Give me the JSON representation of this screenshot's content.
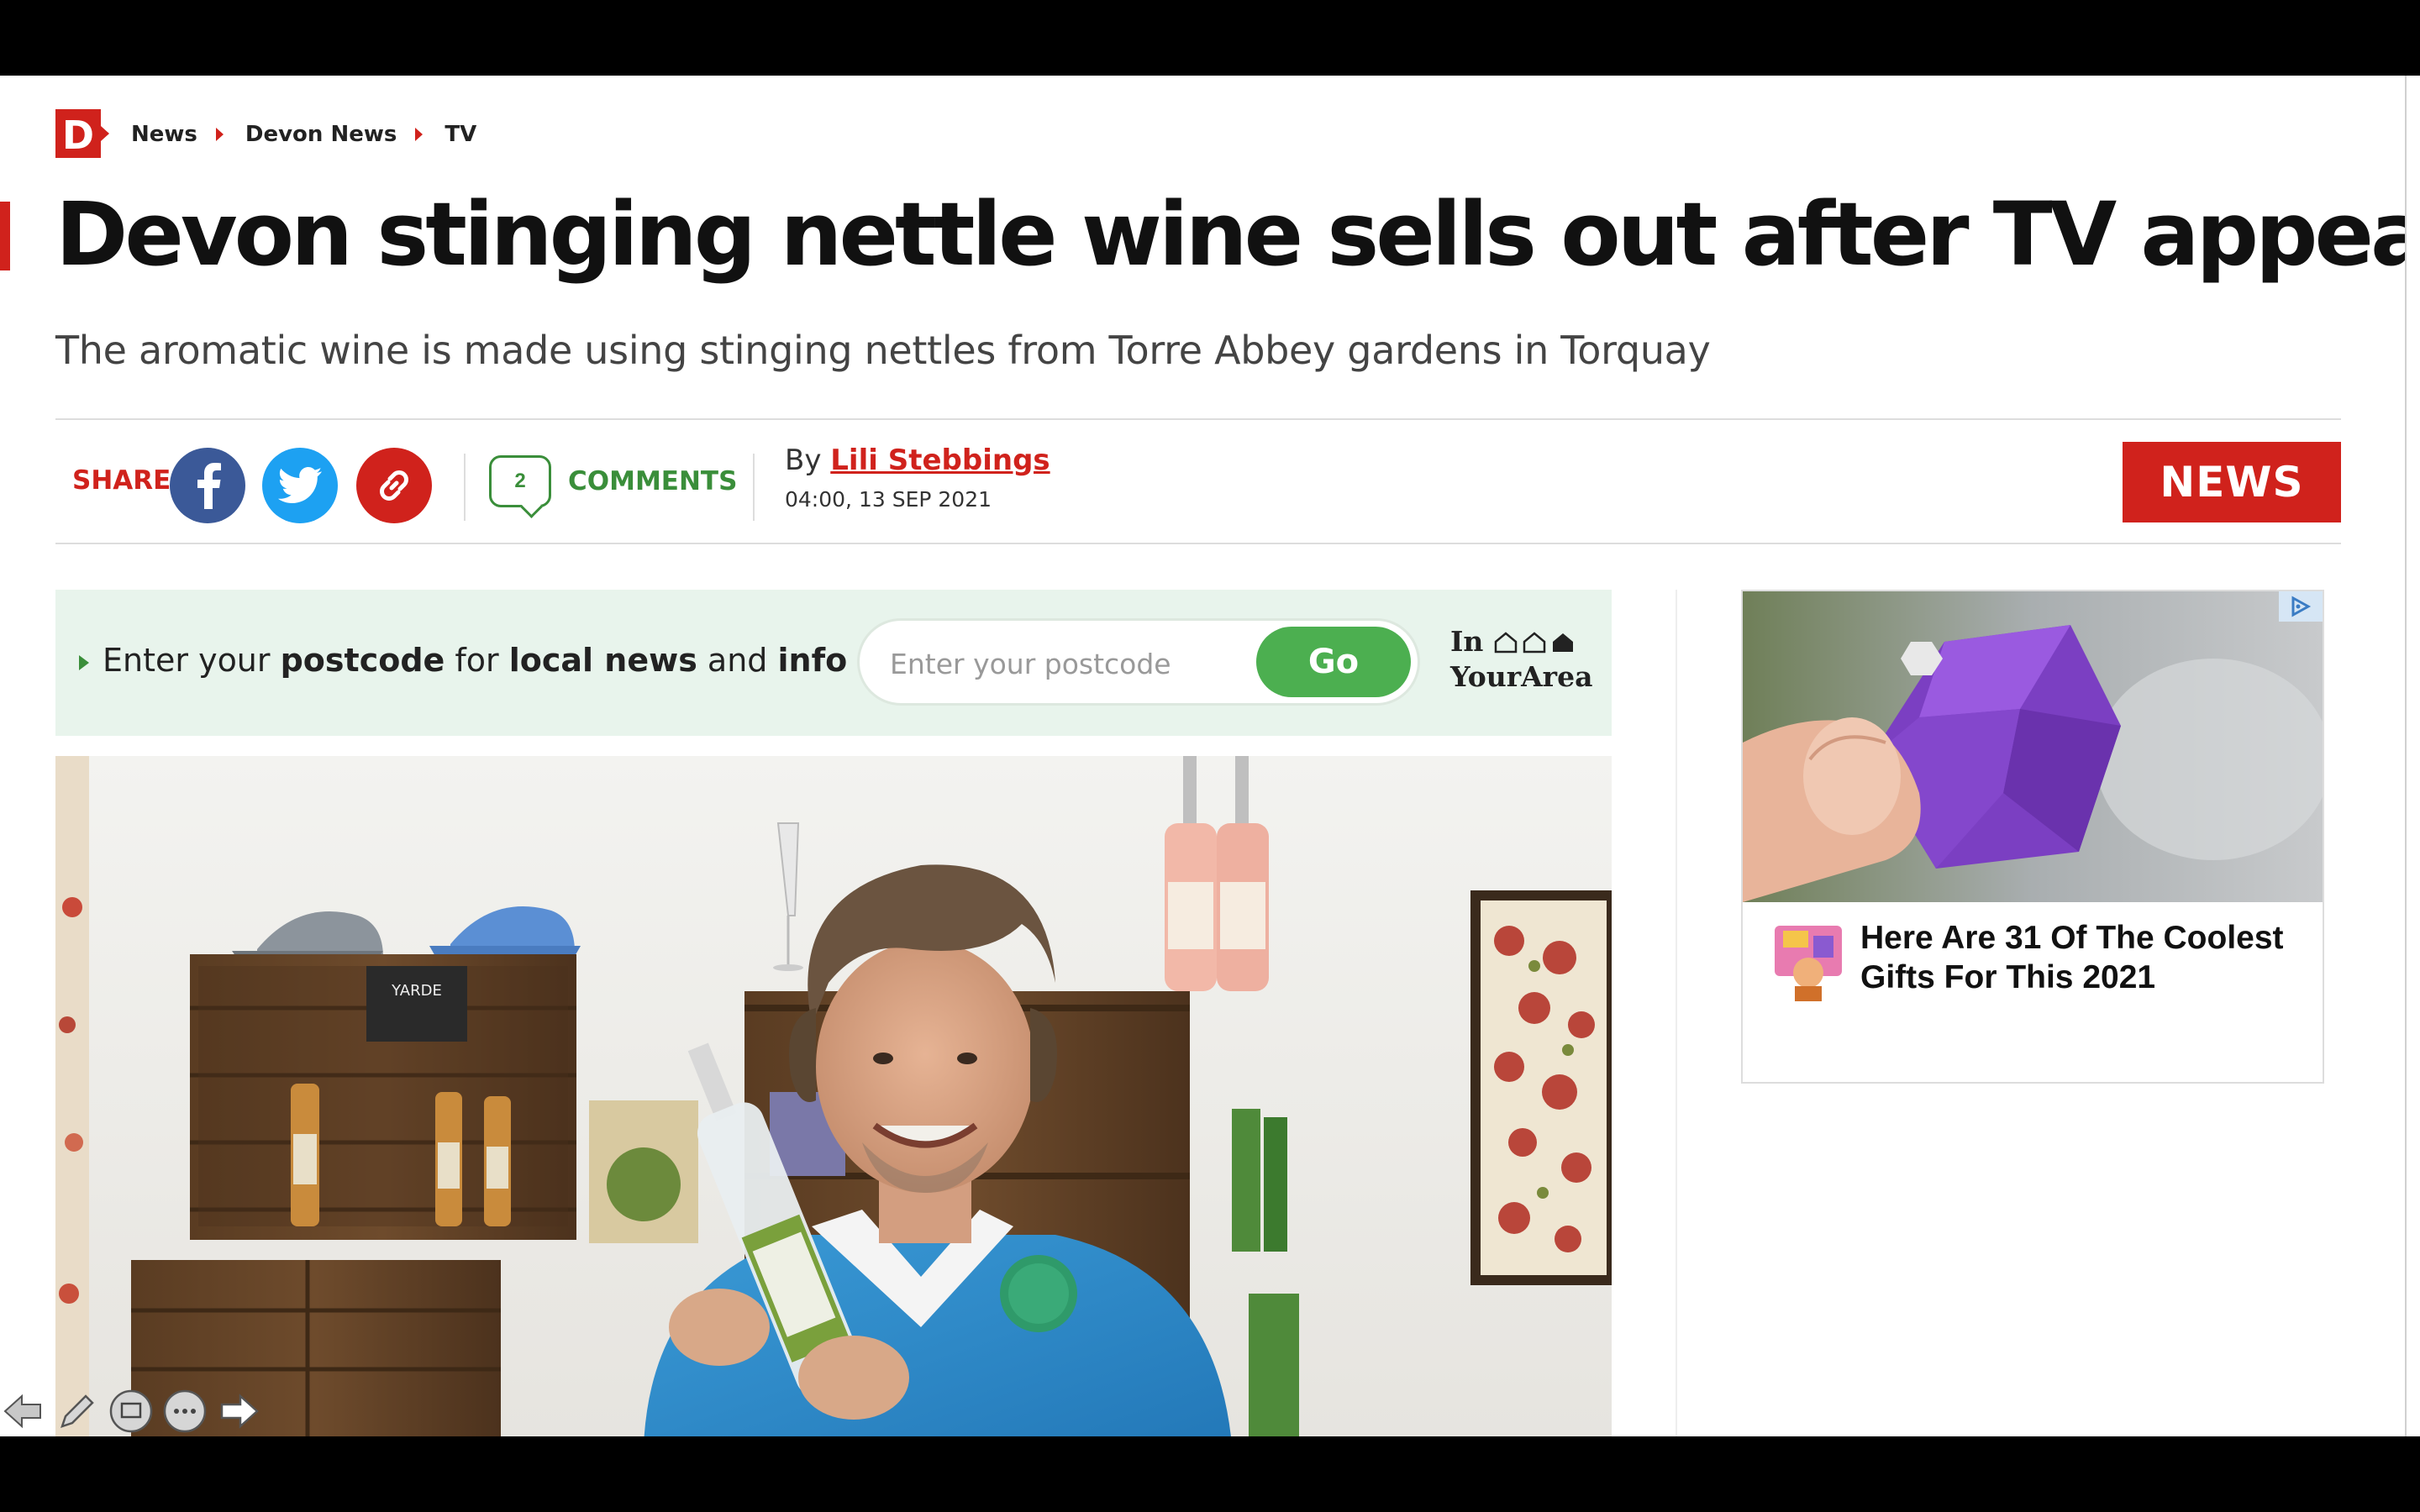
{
  "breadcrumb": {
    "items": [
      "News",
      "Devon News",
      "TV"
    ],
    "logo_letter": "D"
  },
  "article": {
    "headline": "Devon stinging nettle wine sells out after TV appearance",
    "standfirst": "The aromatic wine is made using stinging nettles from Torre Abbey gardens in Torquay",
    "byline_prefix": "By",
    "author": "Lili Stebbings",
    "date": "04:00, 13 SEP 2021",
    "section_badge": "NEWS"
  },
  "share": {
    "label": "SHARE",
    "comments_count": "2",
    "comments_label": "COMMENTS",
    "icons": [
      "facebook-icon",
      "twitter-icon",
      "link-icon"
    ]
  },
  "postcode": {
    "prompt_parts": [
      "Enter your ",
      "postcode",
      " for ",
      "local news",
      " and ",
      "info"
    ],
    "placeholder": "Enter your postcode",
    "button": "Go",
    "brand_in": "In",
    "brand_area": "YourArea"
  },
  "ad": {
    "title": "Here Are 31 Of The Coolest Gifts For This 2021"
  },
  "toolbar": {
    "icons": [
      "back-arrow-icon",
      "pen-icon",
      "screen-icon",
      "more-icon",
      "forward-arrow-icon"
    ]
  },
  "colors": {
    "brand_red": "#d0221c",
    "comments_green": "#3a8e3a",
    "facebook": "#3b5998",
    "twitter": "#1da1f2",
    "postcode_bg": "#e8f4ec",
    "go_button": "#4caf50"
  }
}
